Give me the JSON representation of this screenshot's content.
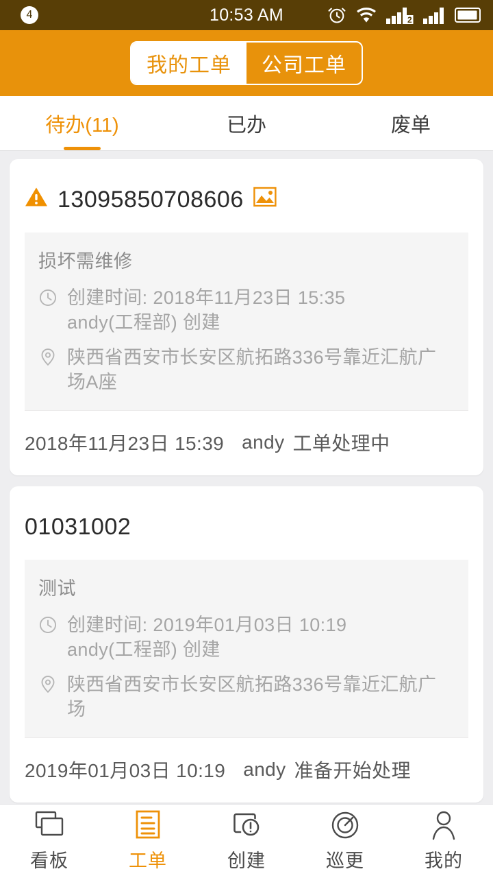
{
  "theme": {
    "accent": "#ee9108",
    "header_bg": "#e8920b",
    "statusbar_bg": "#583e06",
    "page_bg": "#eeeef0",
    "card_bg": "#ffffff",
    "panel_bg": "#f5f5f5",
    "muted_text": "#a5a5a5"
  },
  "status_bar": {
    "notification_count": "4",
    "time": "10:53 AM",
    "icons": [
      "alarm-icon",
      "wifi-icon",
      "signal-1-icon",
      "signal-2-icon",
      "battery-icon"
    ]
  },
  "header": {
    "segments": [
      {
        "label": "我的工单",
        "active": true
      },
      {
        "label": "公司工单",
        "active": false
      }
    ]
  },
  "tabs": [
    {
      "label": "待办(11)",
      "active": true
    },
    {
      "label": "已办",
      "active": false
    },
    {
      "label": "废单",
      "active": false
    }
  ],
  "tickets": [
    {
      "number": "13095850708606",
      "has_warning": true,
      "has_photo": true,
      "subject": "损坏需维修",
      "created_label": "创建时间:",
      "created_time": "2018年11月23日 15:35",
      "creator_line": "andy(工程部) 创建",
      "address_line1": "陕西省西安市长安区航拓路336号靠近汇航广",
      "address_line2": "场A座",
      "footer_time": "2018年11月23日 15:39",
      "footer_user": "andy",
      "footer_status": "工单处理中"
    },
    {
      "number": "01031002",
      "has_warning": false,
      "has_photo": false,
      "subject": "测试",
      "created_label": "创建时间:",
      "created_time": "2019年01月03日 10:19",
      "creator_line": "andy(工程部) 创建",
      "address_line1": "陕西省西安市长安区航拓路336号靠近汇航广",
      "address_line2": "场",
      "footer_time": "2019年01月03日 10:19",
      "footer_user": "andy",
      "footer_status": "准备开始处理"
    }
  ],
  "bottom_nav": [
    {
      "label": "看板",
      "icon": "board-icon",
      "active": false
    },
    {
      "label": "工单",
      "icon": "document-icon",
      "active": true
    },
    {
      "label": "创建",
      "icon": "create-alert-icon",
      "active": false
    },
    {
      "label": "巡更",
      "icon": "patrol-target-icon",
      "active": false
    },
    {
      "label": "我的",
      "icon": "person-icon",
      "active": false
    }
  ]
}
